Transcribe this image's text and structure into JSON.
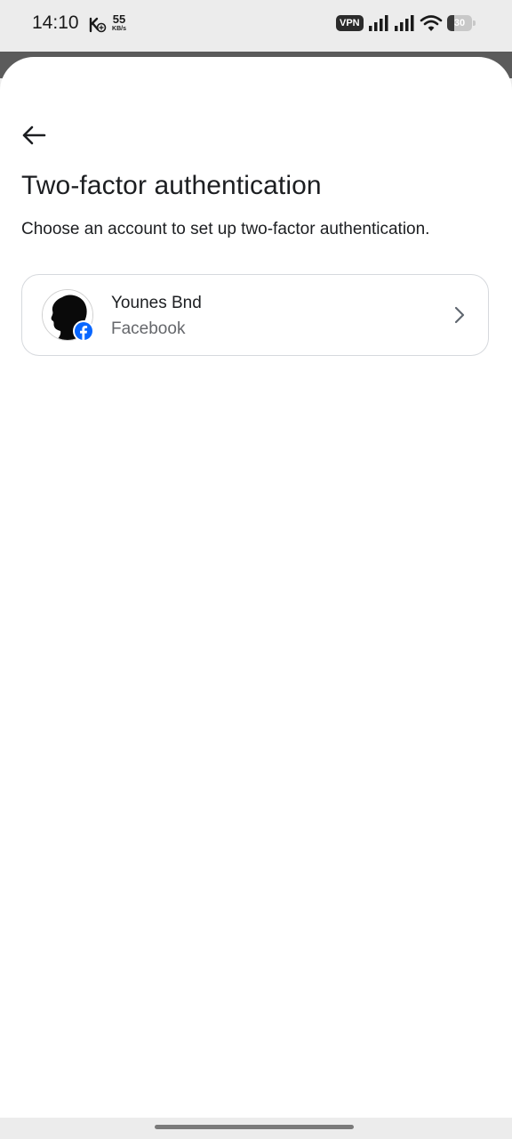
{
  "status_bar": {
    "time": "14:10",
    "net_speed_value": "55",
    "net_speed_unit": "KB/s",
    "vpn_label": "VPN",
    "battery_level": "30",
    "icons": [
      "k-icon",
      "signal-icon",
      "signal-icon",
      "wifi-icon",
      "battery-icon"
    ]
  },
  "header": {
    "back_icon": "arrow-left-icon",
    "title": "Two-factor authentication",
    "subtitle": "Choose an account to set up two-factor authentication."
  },
  "accounts": [
    {
      "name": "Younes Bnd",
      "platform": "Facebook",
      "avatar_icon": "profile-silhouette-avatar",
      "badge_icon": "facebook-icon",
      "chevron_icon": "chevron-right-icon"
    }
  ],
  "colors": {
    "facebook_blue": "#0866ff",
    "text_primary": "#1c1e21",
    "text_secondary": "#65676b",
    "card_border": "#d6d9dd"
  }
}
